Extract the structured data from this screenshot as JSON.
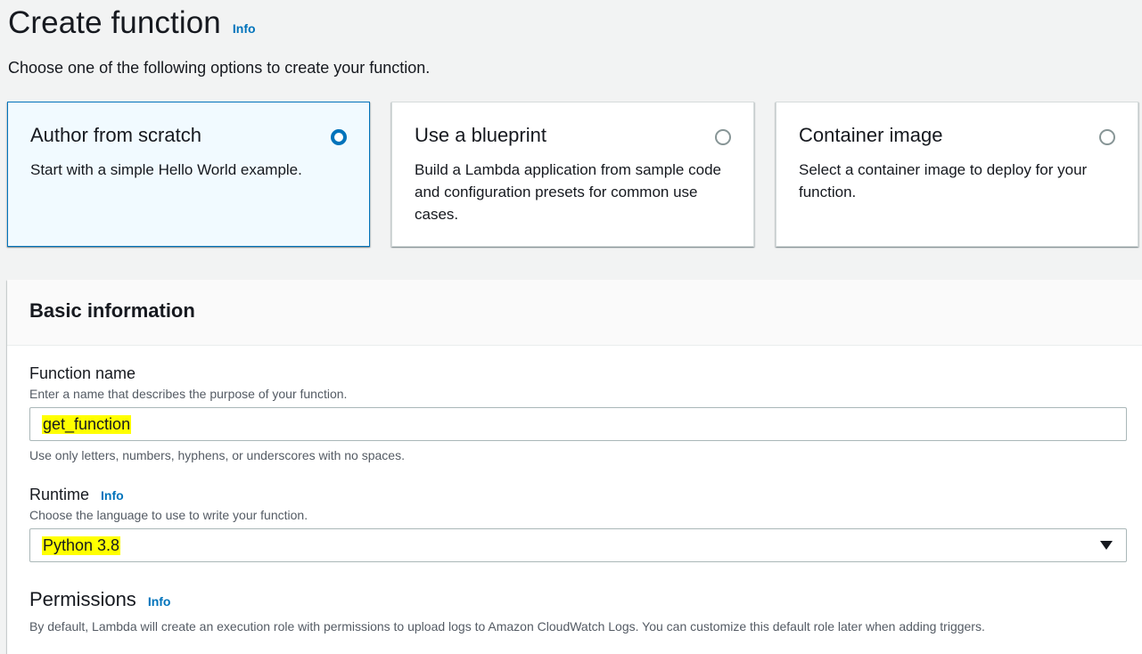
{
  "header": {
    "title": "Create function",
    "info": "Info",
    "description": "Choose one of the following options to create your function."
  },
  "options": [
    {
      "title": "Author from scratch",
      "description": "Start with a simple Hello World example.",
      "selected": true
    },
    {
      "title": "Use a blueprint",
      "description": "Build a Lambda application from sample code and configuration presets for common use cases.",
      "selected": false
    },
    {
      "title": "Container image",
      "description": "Select a container image to deploy for your function.",
      "selected": false
    }
  ],
  "basic_info": {
    "title": "Basic information",
    "function_name": {
      "label": "Function name",
      "description": "Enter a name that describes the purpose of your function.",
      "value": "get_function",
      "constraint": "Use only letters, numbers, hyphens, or underscores with no spaces."
    },
    "runtime": {
      "label": "Runtime",
      "info": "Info",
      "description": "Choose the language to use to write your function.",
      "value": "Python 3.8"
    },
    "permissions": {
      "label": "Permissions",
      "info": "Info",
      "description": "By default, Lambda will create an execution role with permissions to upload logs to Amazon CloudWatch Logs. You can customize this default role later when adding triggers."
    }
  },
  "colors": {
    "accent": "#0073bb",
    "highlight": "#ffff00",
    "selected_tile_bg": "#f1faff"
  }
}
